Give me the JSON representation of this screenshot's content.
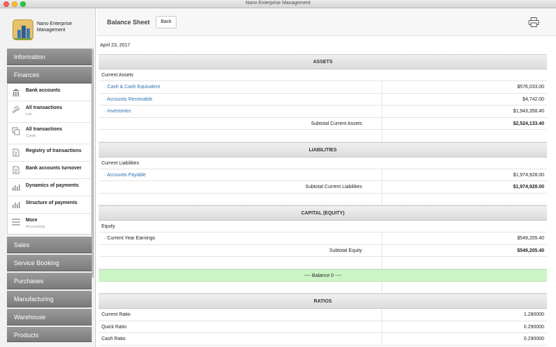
{
  "window": {
    "title": "Nano Enterprise Management"
  },
  "app": {
    "logo_text": "Nano Enterprise Management"
  },
  "sidebar": {
    "nav_top": [
      {
        "label": "Information"
      },
      {
        "label": "Finances"
      }
    ],
    "submenu": [
      {
        "label": "Bank accounts",
        "subtitle": "",
        "icon": "bank-icon"
      },
      {
        "label": "All transactions",
        "subtitle": "List",
        "icon": "list-icon"
      },
      {
        "label": "All transactions",
        "subtitle": "Cards",
        "icon": "cards-icon"
      },
      {
        "label": "Registry of transactions",
        "subtitle": "",
        "icon": "document-icon"
      },
      {
        "label": "Bank accounts turnover",
        "subtitle": "",
        "icon": "document-icon"
      },
      {
        "label": "Dynamics of payments",
        "subtitle": "",
        "icon": "bar-chart-icon"
      },
      {
        "label": "Structure of payments",
        "subtitle": "",
        "icon": "bar-chart-icon"
      },
      {
        "label": "More",
        "subtitle": "Accounting",
        "icon": "menu-icon"
      }
    ],
    "nav_bottom": [
      {
        "label": "Sales"
      },
      {
        "label": "Service Booking"
      },
      {
        "label": "Purchases"
      },
      {
        "label": "Manufacturing"
      },
      {
        "label": "Warehouse"
      },
      {
        "label": "Products"
      }
    ]
  },
  "toolbar": {
    "title": "Balance Sheet",
    "back_label": "Back",
    "print_icon": "printer-icon"
  },
  "report": {
    "date": "April 23, 2017",
    "assets": {
      "header": "ASSETS",
      "group": "Current Assets",
      "rows": [
        {
          "label": "· Cash & Cash Equivalent",
          "value": "$576,033.00"
        },
        {
          "label": "· Accounts Receivable",
          "value": "$4,742.00"
        },
        {
          "label": "· Inventories",
          "value": "$1,943,358.40"
        }
      ],
      "subtotal_label": "Subtotal Current Assets",
      "subtotal_value": "$2,524,133.40"
    },
    "liabilities": {
      "header": "LIABILITIES",
      "group": "Current Liabilities",
      "rows": [
        {
          "label": "· Accounts Payable",
          "value": "$1,974,928.00"
        }
      ],
      "subtotal_label": "Subtotal Current Liabilities",
      "subtotal_value": "$1,974,928.00"
    },
    "equity": {
      "header": "CAPITAL (EQUITY)",
      "group": "Equity",
      "rows": [
        {
          "label": "· Current Year Earnings",
          "value": "$549,205.40"
        }
      ],
      "subtotal_label": "Subtotal Equity",
      "subtotal_value": "$549,205.40"
    },
    "balance_text": "----   Balance 0   ----",
    "ratios": {
      "header": "RATIOS",
      "rows": [
        {
          "label": "Current Ratio",
          "value": "1.280000"
        },
        {
          "label": "Quick Ratio",
          "value": "0.290000"
        },
        {
          "label": "Cash Ratio",
          "value": "0.290000"
        }
      ]
    }
  },
  "colors": {
    "balance_bg": "#ccf5c6",
    "link": "#2f6fb0",
    "nav_button": "#8a8a8a"
  }
}
